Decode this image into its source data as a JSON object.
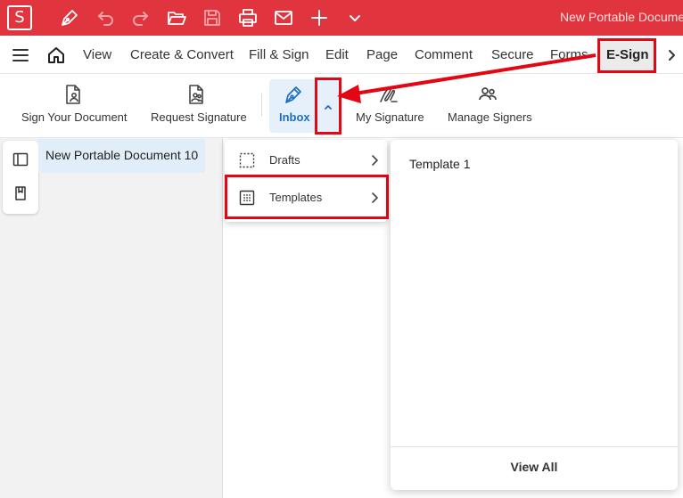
{
  "title_bar": {
    "logo_letter": "S",
    "window_title": "New Portable Docume",
    "icons": [
      "pen-icon",
      "undo-icon",
      "redo-icon",
      "open-folder-icon",
      "save-icon",
      "print-icon",
      "mail-icon",
      "add-icon",
      "chevron-down-icon"
    ]
  },
  "menu_bar": {
    "items": [
      "View",
      "Create & Convert",
      "Fill & Sign",
      "Edit",
      "Page",
      "Comment",
      "Secure",
      "Forms",
      "E-Sign"
    ],
    "active": "E-Sign"
  },
  "ribbon": {
    "sign_your_document": "Sign Your Document",
    "request_signature": "Request Signature",
    "inbox": "Inbox",
    "my_signature": "My Signature",
    "manage_signers": "Manage Signers"
  },
  "document_tab": {
    "label": "New Portable Document 10"
  },
  "inbox_menu": {
    "items": [
      {
        "label": "Drafts"
      },
      {
        "label": "Templates"
      }
    ]
  },
  "templates_panel": {
    "items": [
      "Template 1"
    ],
    "view_all": "View All"
  },
  "colors": {
    "brand_red": "#e0353e",
    "highlight_red": "#e30613",
    "accent_blue": "#1e6fc3",
    "active_bg": "#e5f0fa"
  }
}
